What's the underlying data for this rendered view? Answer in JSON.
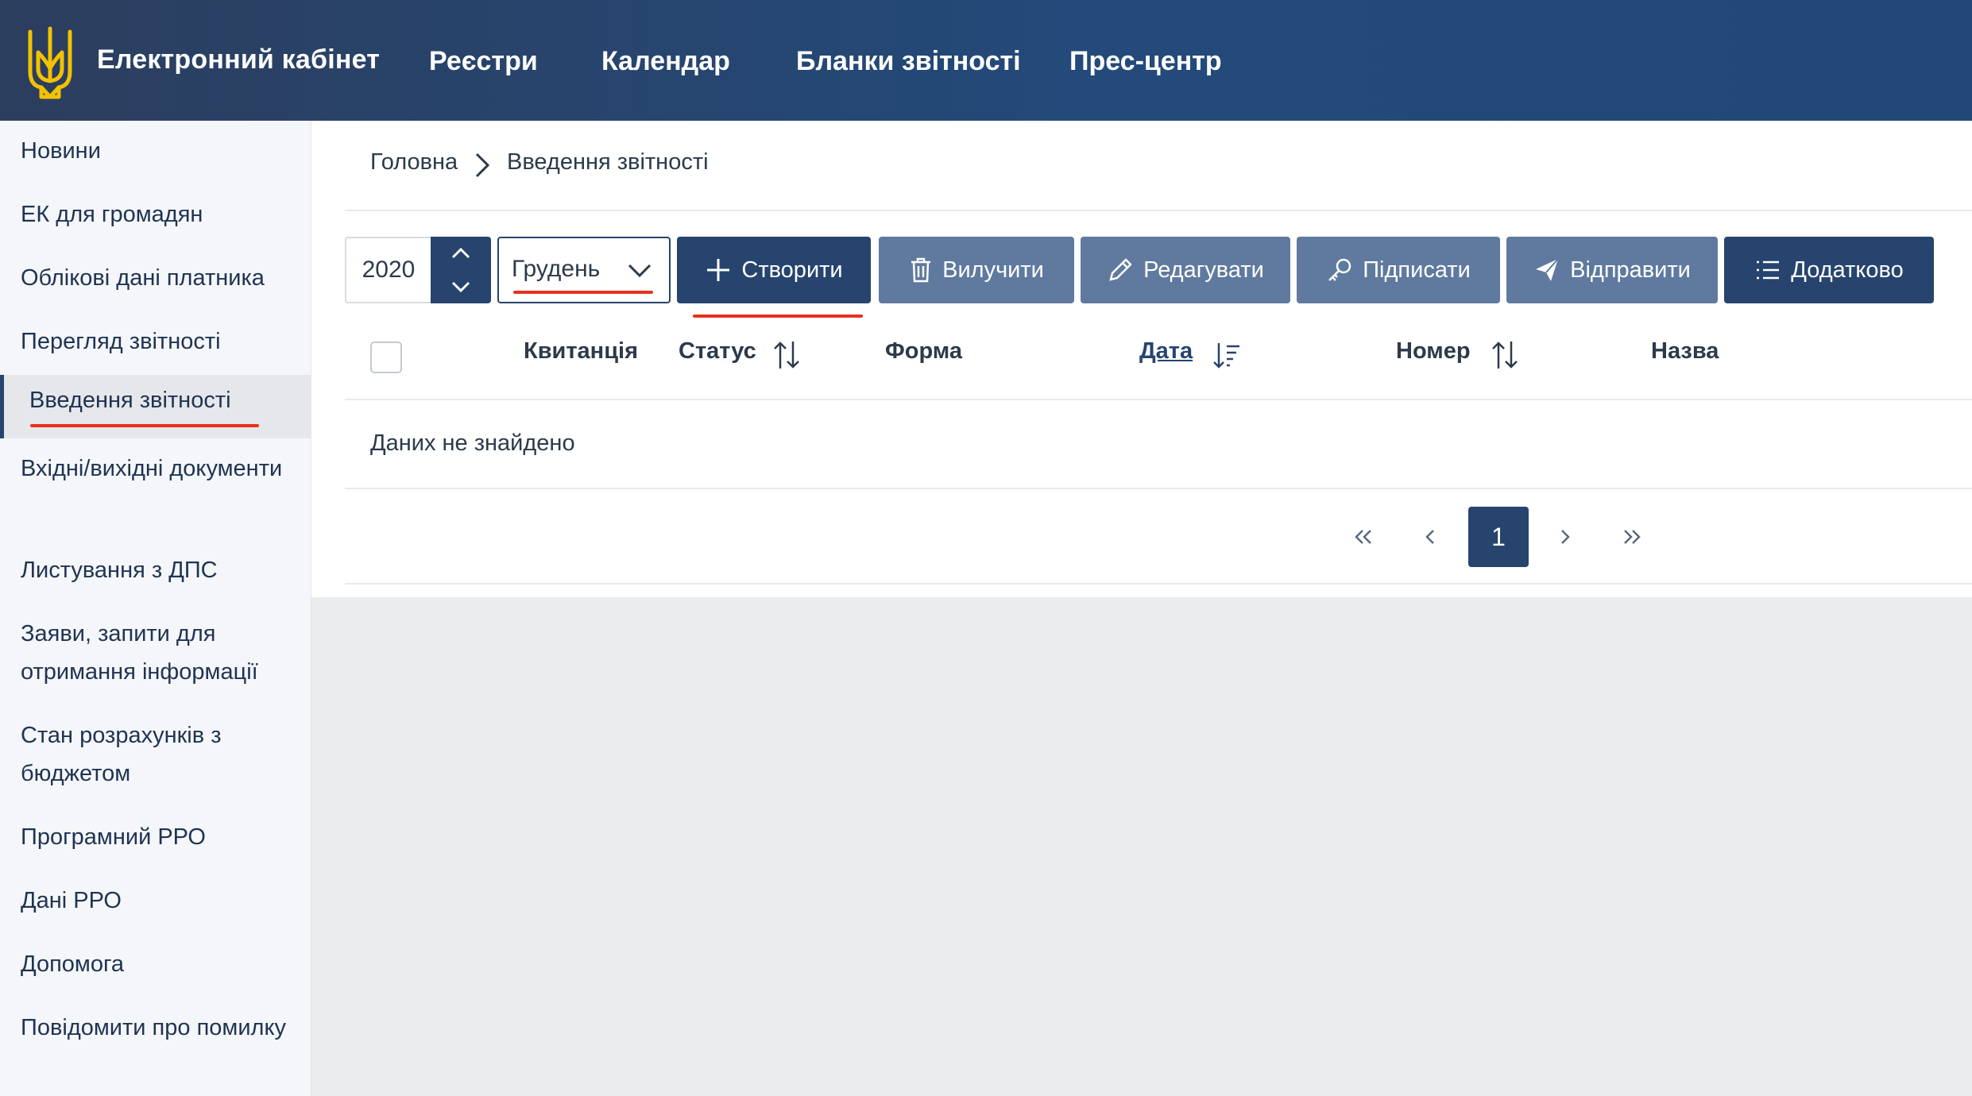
{
  "header": {
    "brand": "Електронний кабінет",
    "nav": [
      "Реєстри",
      "Календар",
      "Бланки звітності",
      "Прес-центр"
    ]
  },
  "sidebar": {
    "items": [
      "Новини",
      "ЕК для громадян",
      "Облікові дані платника",
      "Перегляд звітності",
      "Введення звітності",
      "Вхідні/вихідні документи",
      "Листування з ДПС",
      "Заяви, запити для отримання інформації",
      "Стан розрахунків з бюджетом",
      "Програмний РРО",
      "Дані РРО",
      "Допомога",
      "Повідомити про помилку"
    ],
    "active_index": 4
  },
  "breadcrumb": {
    "home": "Головна",
    "current": "Введення звітності"
  },
  "toolbar": {
    "year": "2020",
    "month": "Грудень",
    "create": "Створити",
    "remove": "Вилучити",
    "edit": "Редагувати",
    "sign": "Підписати",
    "send": "Відправити",
    "more": "Додатково"
  },
  "table": {
    "columns": [
      "Квитанція",
      "Статус",
      "Форма",
      "Дата",
      "Номер",
      "Назва"
    ],
    "empty_text": "Даних не знайдено"
  },
  "pagination": {
    "current_page": "1"
  },
  "colors": {
    "header": "#234a7a",
    "primary": "#26446e",
    "muted_button": "#5f7a9e",
    "annotation": "#e8321e"
  },
  "icons": [
    "trident-logo",
    "chevron-right-icon",
    "chevron-up-icon",
    "chevron-down-icon",
    "plus-icon",
    "trash-icon",
    "pencil-icon",
    "key-icon",
    "paper-plane-icon",
    "list-icon",
    "sort-icon",
    "sort-desc-icon",
    "double-chevron-left-icon",
    "chevron-left-icon",
    "double-chevron-right-icon"
  ]
}
